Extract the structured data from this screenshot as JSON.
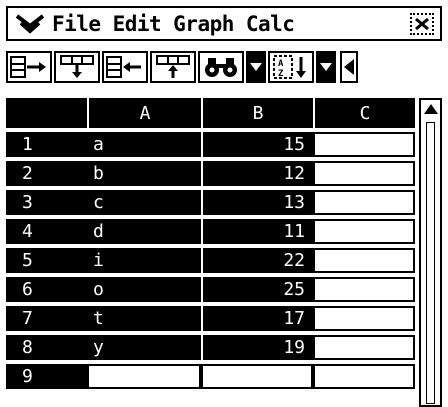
{
  "menu": {
    "icon": "double-chevron-down-icon",
    "items": [
      "File",
      "Edit",
      "Graph",
      "Calc"
    ],
    "close_icon": "close-icon"
  },
  "toolbar": {
    "buttons": [
      {
        "name": "insert-row-right-icon"
      },
      {
        "name": "insert-col-down-icon"
      },
      {
        "name": "delete-row-left-icon"
      },
      {
        "name": "delete-col-up-icon"
      },
      {
        "name": "binoculars-search-icon"
      },
      {
        "name": "sort-az-icon"
      }
    ],
    "dropdown_icon": "triangle-down-icon",
    "back_icon": "triangle-left-icon"
  },
  "table": {
    "columns": [
      "",
      "A",
      "B",
      "C"
    ],
    "rows": [
      {
        "idx": "1",
        "a": "a",
        "b": "15",
        "c": ""
      },
      {
        "idx": "2",
        "a": "b",
        "b": "12",
        "c": ""
      },
      {
        "idx": "3",
        "a": "c",
        "b": "13",
        "c": ""
      },
      {
        "idx": "4",
        "a": "d",
        "b": "11",
        "c": ""
      },
      {
        "idx": "5",
        "a": "i",
        "b": "22",
        "c": ""
      },
      {
        "idx": "6",
        "a": "o",
        "b": "25",
        "c": ""
      },
      {
        "idx": "7",
        "a": "t",
        "b": "17",
        "c": ""
      },
      {
        "idx": "8",
        "a": "y",
        "b": "19",
        "c": ""
      },
      {
        "idx": "9",
        "a": "",
        "b": "",
        "c": ""
      }
    ]
  }
}
